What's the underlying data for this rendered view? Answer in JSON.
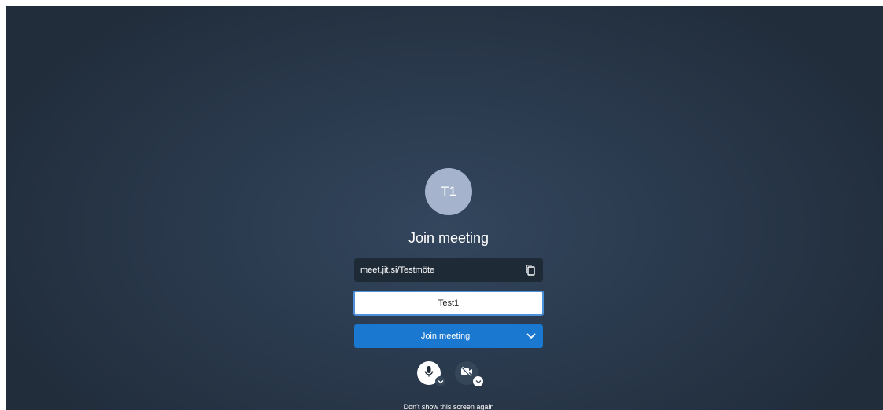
{
  "avatar": {
    "initials": "T1"
  },
  "title": "Join meeting",
  "meeting_url": {
    "text": "meet.jit.si/Testmöte",
    "copy_icon": "copy-icon"
  },
  "name_input": {
    "value": "Test1"
  },
  "join_button": {
    "label": "Join meeting",
    "dropdown_icon": "chevron-down-icon"
  },
  "media_controls": {
    "mic": {
      "icon": "microphone-icon",
      "options_icon": "chevron-down-icon"
    },
    "camera": {
      "icon": "camera-off-icon",
      "options_icon": "chevron-down-icon"
    }
  },
  "footer": {
    "dont_show_label": "Don't show this screen again"
  },
  "colors": {
    "background": "#2b3b4f",
    "avatar": "#a5b4cc",
    "url_box": "#1f2a37",
    "input_border": "#4d8fd8",
    "primary_button": "#1a78d0"
  }
}
